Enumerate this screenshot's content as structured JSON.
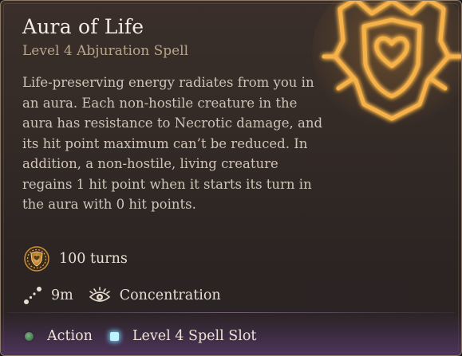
{
  "spell": {
    "name": "Aura of Life",
    "level_school": "Level 4 Abjuration Spell",
    "description": "Life-preserving energy radiates from you in an aura. Each non-hostile creature in the aura has resistance to Necrotic damage, and its hit point maximum can’t be reduced. In addition, a non-hostile, living creature regains 1 hit point when it starts its turn in the aura with 0 hit points.",
    "duration": "100 turns",
    "range": "9m",
    "concentration": "Concentration"
  },
  "footer": {
    "action_label": "Action",
    "slot_label": "Level 4 Spell Slot"
  },
  "icons": {
    "spell_art": "aura-of-life-spell-art",
    "duration": "hourglass-shield-icon",
    "range": "range-dotted-line-icon",
    "concentration": "concentration-eye-icon",
    "action": "action-dot-icon",
    "slot": "spell-slot-icon"
  },
  "colors": {
    "accent_gold": "#f0a63a",
    "action_green": "#4f8a5a",
    "slot_cyan": "#bff3ff",
    "footer_purple": "#5a3a6c"
  }
}
